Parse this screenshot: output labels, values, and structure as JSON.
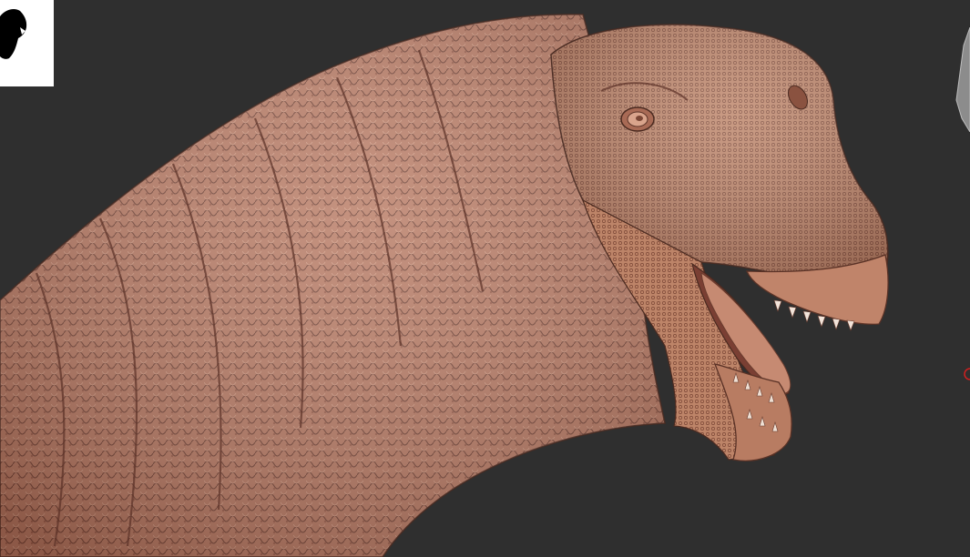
{
  "viewport": {
    "background_color": "#2f2f2f",
    "model": "dinosaur-head-sculpt",
    "model_skin_color": "#b97b63",
    "thumbnail_icon": "dinosaur-silhouette-icon",
    "side_object_color": "#8c8c8c",
    "marker_color": "#d02020"
  }
}
